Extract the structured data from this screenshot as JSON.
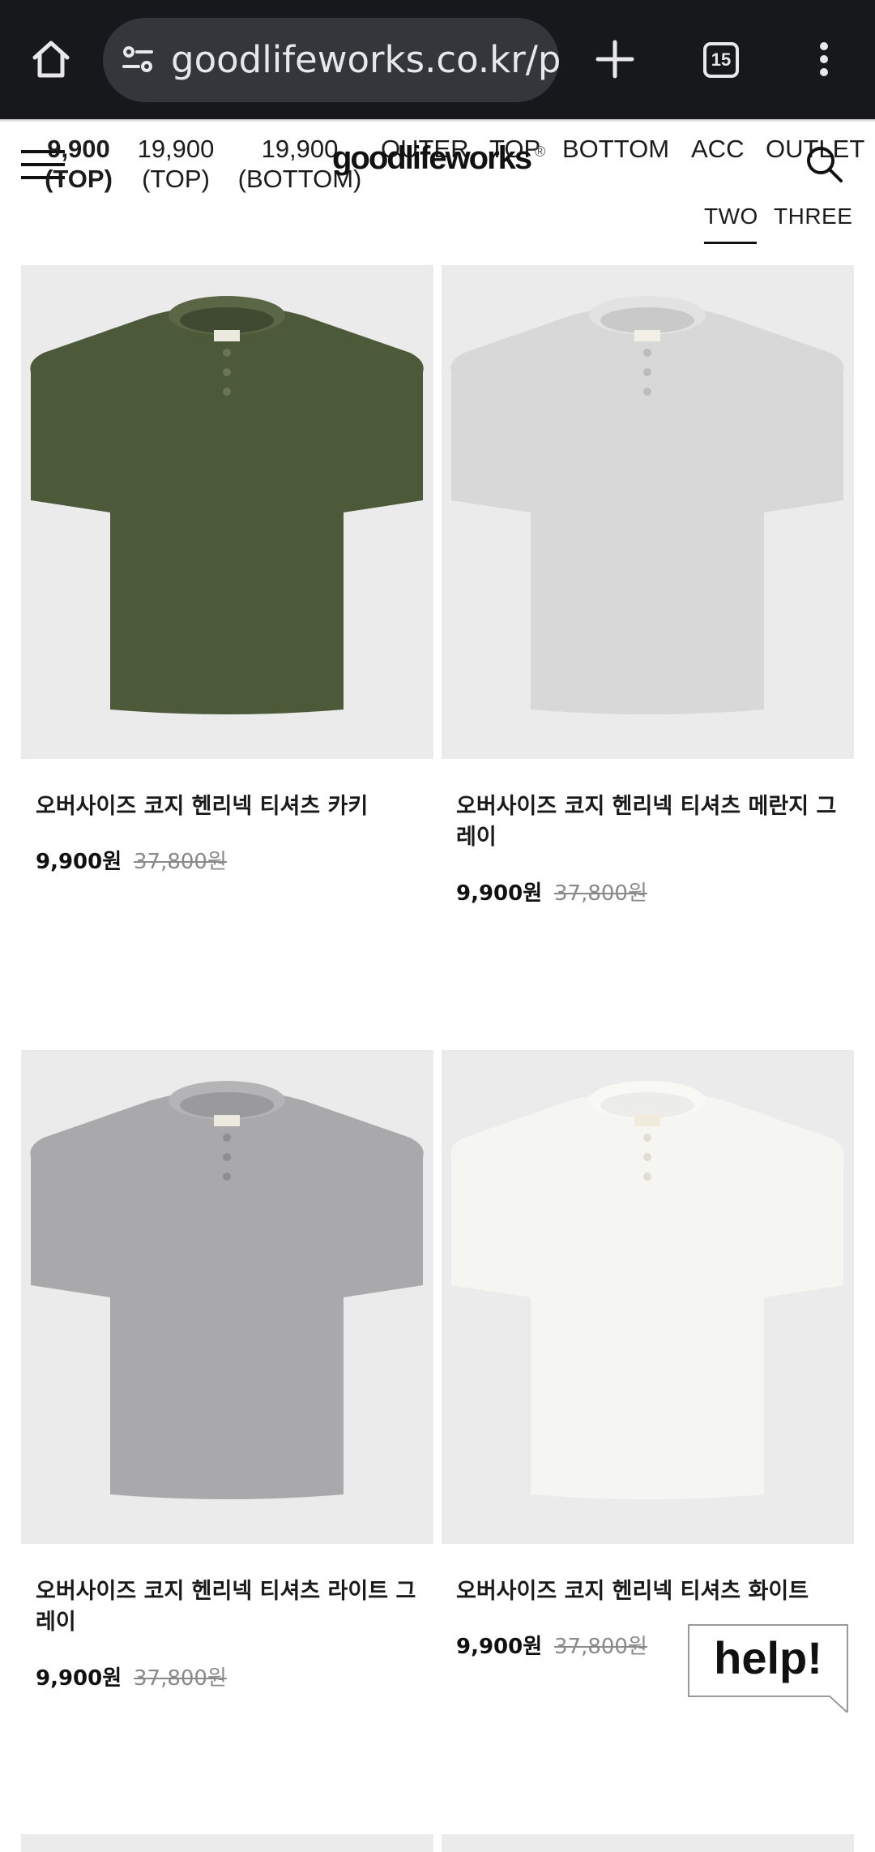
{
  "browser": {
    "url": "goodlifeworks.co.kr/p",
    "tab_count": "15"
  },
  "header": {
    "logo": "goodlifeworks",
    "logo_mark": "®",
    "nav": [
      {
        "line1": "9,900",
        "line2": "(TOP)"
      },
      {
        "line1": "19,900",
        "line2": "(TOP)"
      },
      {
        "line1": "19,900",
        "line2": "(BOTTOM)"
      },
      {
        "line1": "OUTER",
        "line2": ""
      },
      {
        "line1": "TOP",
        "line2": ""
      },
      {
        "line1": "BOTTOM",
        "line2": ""
      },
      {
        "line1": "ACC",
        "line2": ""
      },
      {
        "line1": "OUTLET",
        "line2": ""
      }
    ]
  },
  "view_toggle": {
    "two": "TWO",
    "three": "THREE",
    "selected": "TWO"
  },
  "products": [
    {
      "name": "오버사이즈 코지 헨리넥 티셔츠 카키",
      "price": "9,900원",
      "original_price": "37,800원",
      "color": "#4d5a3a"
    },
    {
      "name": "오버사이즈 코지 헨리넥 티셔츠 메란지 그레이",
      "price": "9,900원",
      "original_price": "37,800원",
      "color": "#d8d8d8"
    },
    {
      "name": "오버사이즈 코지 헨리넥 티셔츠 라이트 그레이",
      "price": "9,900원",
      "original_price": "37,800원",
      "color": "#a9a9ab"
    },
    {
      "name": "오버사이즈 코지 헨리넥 티셔츠 화이트",
      "price": "9,900원",
      "original_price": "37,800원",
      "color": "#f5f5f1"
    }
  ],
  "help_button": "help!"
}
